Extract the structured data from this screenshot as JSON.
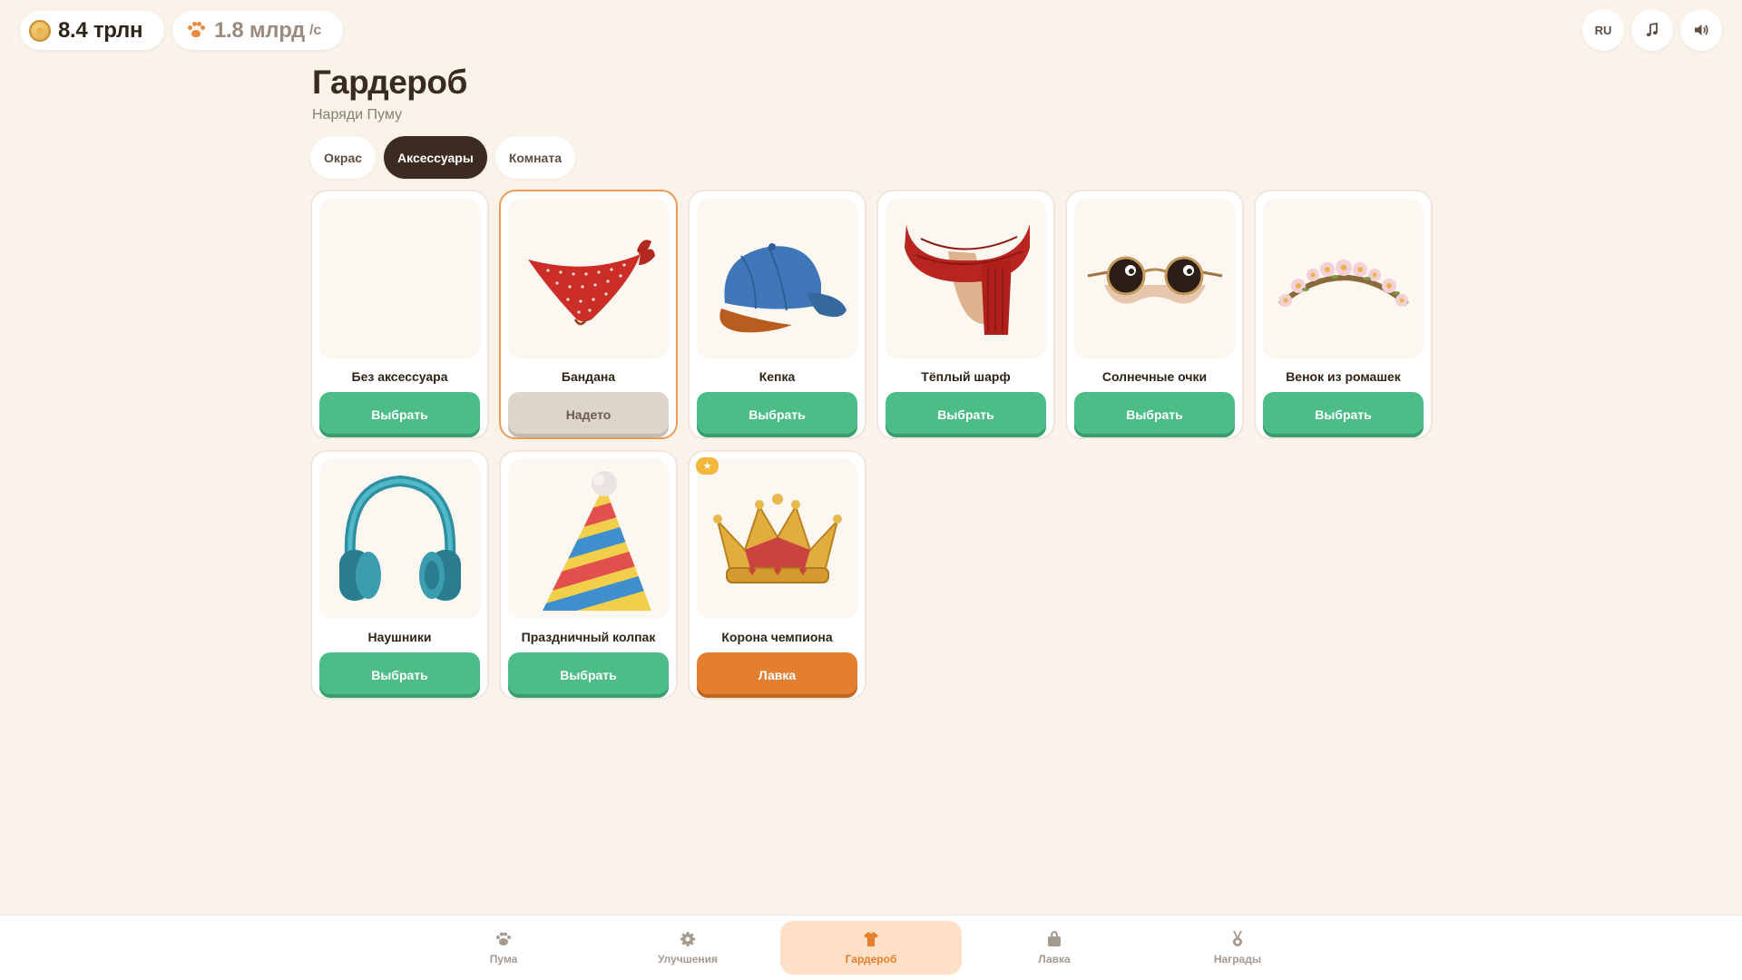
{
  "topbar": {
    "coins": "8.4 трлн",
    "rate": "1.8 млрд",
    "rate_unit": "/с",
    "lang": "RU",
    "music_icon": "music-note-icon",
    "sound_icon": "speaker-icon"
  },
  "header": {
    "title": "Гардероб",
    "subtitle": "Наряди Пуму"
  },
  "tabs": [
    {
      "label": "Окрас",
      "active": false
    },
    {
      "label": "Аксессуары",
      "active": true
    },
    {
      "label": "Комната",
      "active": false
    }
  ],
  "items": [
    {
      "name": "Без аксессуара",
      "button": "Выбрать",
      "state": "select",
      "image": "none"
    },
    {
      "name": "Бандана",
      "button": "Надето",
      "state": "worn",
      "image": "bandana"
    },
    {
      "name": "Кепка",
      "button": "Выбрать",
      "state": "select",
      "image": "cap"
    },
    {
      "name": "Тёплый шарф",
      "button": "Выбрать",
      "state": "select",
      "image": "scarf"
    },
    {
      "name": "Солнечные очки",
      "button": "Выбрать",
      "state": "select",
      "image": "sunglasses"
    },
    {
      "name": "Венок из ромашек",
      "button": "Выбрать",
      "state": "select",
      "image": "daisy-wreath"
    },
    {
      "name": "Наушники",
      "button": "Выбрать",
      "state": "select",
      "image": "headphones"
    },
    {
      "name": "Праздничный колпак",
      "button": "Выбрать",
      "state": "select",
      "image": "party-hat"
    },
    {
      "name": "Корона чемпиона",
      "button": "Лавка",
      "state": "shop",
      "image": "crown",
      "badge": "★"
    }
  ],
  "nav": [
    {
      "label": "Пума",
      "icon": "paw-icon",
      "active": false
    },
    {
      "label": "Улучшения",
      "icon": "gear-icon",
      "active": false
    },
    {
      "label": "Гардероб",
      "icon": "shirt-icon",
      "active": true
    },
    {
      "label": "Лавка",
      "icon": "bag-icon",
      "active": false
    },
    {
      "label": "Награды",
      "icon": "medal-icon",
      "active": false
    }
  ],
  "colors": {
    "background": "#faf3ea",
    "select_button": "#4dbd88",
    "shop_button": "#e47f2f",
    "active_tab": "#3b2b20",
    "selected_border": "#ec9a56"
  }
}
